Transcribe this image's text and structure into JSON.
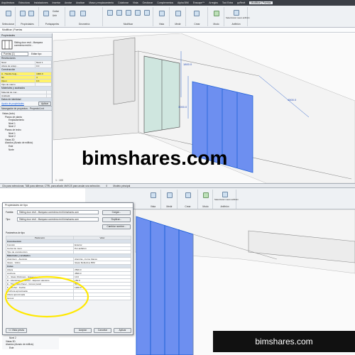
{
  "ribbon_tabs": [
    "Arquitectura",
    "Estructura",
    "Instalaciones",
    "Insertar",
    "Anotar",
    "Analizar",
    "Masa y emplazamiento",
    "Colaborar",
    "Vista",
    "Gestionar",
    "Complementos",
    "Alpha BIM",
    "Enscape™",
    "Arreglos",
    "Tool Extra",
    "pyRevit",
    "Modificar | Puertas"
  ],
  "ribbon_groups": [
    "Seleccionar",
    "Propiedades",
    "Portapapeles",
    "Geometría",
    "Modificar",
    "Vista",
    "Medir",
    "Crear",
    "Modo",
    "Anfitrión"
  ],
  "ribbon_extra": {
    "cut": "Cortar",
    "join": "Unir",
    "group": "Recortar",
    "select_new_host": "Seleccionar nuevo anfitrión"
  },
  "context_bar": "Modificar | Puertas",
  "properties": {
    "header": "Propiedades",
    "type_name": "Sliding door revit - Mampara corredera revit bi...",
    "filter": "Puertas (1)",
    "edit_type": "Editar tipo",
    "groups": [
      "Restricciones",
      "Construcción",
      "Materiales y acabados",
      "Datos de identidad"
    ],
    "rows": [
      {
        "k": "Nivel",
        "v": "Nivel 1"
      },
      {
        "k": "Altura de antep...",
        "v": "0.0"
      },
      {
        "k": "A - Handle heig...",
        "v": "1000.0"
      },
      {
        "k": "Nb",
        "v": "4"
      },
      {
        "k": "Open",
        "v": "0.3"
      },
      {
        "k": "Tipo de marco",
        "v": ""
      },
      {
        "k": "Material de mar...",
        "v": ""
      },
      {
        "k": "Acabado",
        "v": ""
      }
    ],
    "help_link": "Ayuda de propiedades",
    "apply": "Aplicar"
  },
  "project_browser": {
    "header": "Navegador de proyectos - Proyecto1.rvt",
    "items": [
      "Vistas (todo)",
      "Planos de planta",
      "Emplazamiento",
      "Nivel 1",
      "Nivel 2",
      "Planos de techo",
      "Nivel 1",
      "Nivel 2",
      "Vistas 3D",
      "Alzados (Alzado de edificio)",
      "Este",
      "Norte"
    ]
  },
  "view_labels": {
    "dim_top": "1800.0",
    "dim_mid": "3000.0",
    "dim_right": "4500.0",
    "scale": "1 : 100"
  },
  "status_text": "Clic para seleccionar, TAB para alternar, CTRL para añadir, MAYÚS para anular una selección.",
  "status_values": [
    "0",
    "Modelo principal"
  ],
  "ribbon2_labels": [
    "Vista",
    "Medir",
    "Crear",
    "Modo",
    "Anfitrión",
    "Seleccionar nuevo anfitrión"
  ],
  "dialog": {
    "title": "Propiedades de tipo",
    "family_label": "Familia:",
    "family_value": "Sliding door revit - Mampara corredera revit bimshares.com",
    "type_label": "Tipo:",
    "type_value": "Sliding door revit - Mampara corredera revit bimshares.com",
    "load": "Cargar...",
    "duplicate": "Duplicar...",
    "rename": "Cambiar nombre...",
    "params_label": "Parámetros de tipo",
    "col_param": "Parámetro",
    "col_value": "Valor",
    "groups": [
      "Construcción",
      "Materiales y acabados",
      "Cotas"
    ],
    "rows_construction": [
      {
        "k": "Función",
        "v": "Exterior"
      },
      {
        "k": "Cerrar de muro",
        "v": "Por anfitrión"
      },
      {
        "k": "Tipo de construcción",
        "v": ""
      }
    ],
    "rows_materials": [
      {
        "k": "Aluminum - Aluminio",
        "v": "Aluminio, cromo blanco"
      },
      {
        "k": "Glass - Vidrio",
        "v": "Glass Reflective BIM"
      }
    ],
    "rows_dims": [
      {
        "k": "Altura",
        "v": "2500.0"
      },
      {
        "k": "Anchura",
        "v": "4500.0"
      },
      {
        "k": "C - Glass thickness - Espesor vidrio",
        "v": "10.0"
      },
      {
        "k": "D - Aluminium thickness - Espesor aluminio",
        "v": "150.0"
      },
      {
        "k": "E - Thickness Panel - Grosor panel",
        "v": "50.0"
      },
      {
        "k": "F - Anchor - Fecha",
        "v": "1200.0"
      },
      {
        "k": "Anchura aproximada",
        "v": ""
      },
      {
        "k": "Altura aproximada",
        "v": ""
      },
      {
        "k": "Grosor",
        "v": ""
      }
    ],
    "preview": "<< Vista previa",
    "ok": "Aceptar",
    "cancel": "Cancelar",
    "apply": "Aplicar"
  },
  "lower_browser": [
    "Nivel 2",
    "Vistas 3D",
    "Alzados (Alzado de edificio)",
    "Este"
  ],
  "watermark": "bimshares.com",
  "accent": "#1d5fd6",
  "glass_blue": "#6d8ff0",
  "highlight": "#ffe800"
}
